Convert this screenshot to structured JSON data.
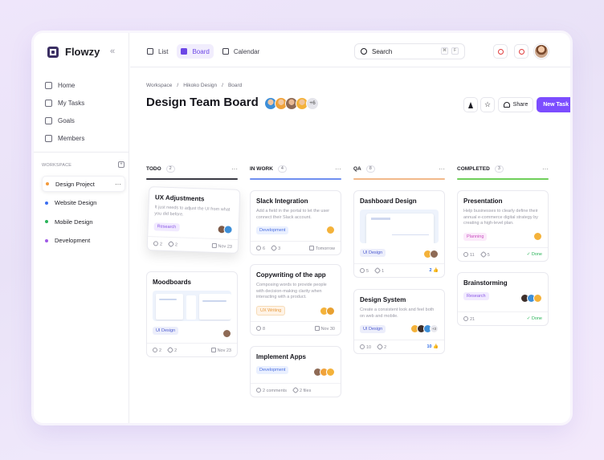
{
  "app": {
    "name": "Flowzy",
    "collapse_icon": "chevrons-left-icon"
  },
  "nav": [
    {
      "label": "Home",
      "icon": "home-icon"
    },
    {
      "label": "My Tasks",
      "icon": "check-square-icon"
    },
    {
      "label": "Goals",
      "icon": "trophy-icon"
    },
    {
      "label": "Members",
      "icon": "users-icon"
    }
  ],
  "workspace": {
    "label": "WORKSPACE",
    "projects": [
      {
        "label": "Design Project",
        "color": "#f39a3c",
        "active": true
      },
      {
        "label": "Website Design",
        "color": "#3b6ef0",
        "active": false
      },
      {
        "label": "Mobile Design",
        "color": "#2bb45a",
        "active": false
      },
      {
        "label": "Development",
        "color": "#a05be6",
        "active": false
      }
    ]
  },
  "views": [
    {
      "label": "List",
      "active": false
    },
    {
      "label": "Board",
      "active": true
    },
    {
      "label": "Calendar",
      "active": false
    }
  ],
  "search": {
    "label": "Search",
    "key1": "⌘",
    "key2": "F"
  },
  "breadcrumb": [
    "Workspace",
    "Hikoko Design",
    "Board"
  ],
  "page_title": "Design Team Board",
  "members_more": "+6",
  "actions": {
    "share": "Share",
    "new_task": "New Task"
  },
  "accent": "#7c4dff",
  "columns": [
    {
      "title": "TODO",
      "count": "2",
      "color": "#3a3a44"
    },
    {
      "title": "IN WORK",
      "count": "4",
      "color": "#6f8ff0"
    },
    {
      "title": "QA",
      "count": "8",
      "color": "#f2b98a"
    },
    {
      "title": "COMPLETED",
      "count": "3",
      "color": "#6fcf5a"
    }
  ],
  "cards": {
    "ux": {
      "title": "UX Adjustments",
      "desc": "It just needs to adjust the UI from what you did before.",
      "tag": "Research",
      "comments": "2",
      "links": "2",
      "date": "Nov 23"
    },
    "moodboards": {
      "title": "Moodboards",
      "tag": "UI Design",
      "comments": "2",
      "links": "2",
      "date": "Nov 23"
    },
    "slack": {
      "title": "Slack Integration",
      "desc": "Add a field in the portal to let the user connect their Slack account.",
      "tag": "Development",
      "comments": "6",
      "links": "3",
      "date": "Tomorrow"
    },
    "copy": {
      "title": "Copywriting of the app",
      "desc": "Composing words to provide people with decision-making clarity when interacting with a product.",
      "tag": "UX Writing",
      "comments": "8",
      "date": "Nov 30"
    },
    "apps": {
      "title": "Implement Apps",
      "tag": "Development",
      "comments": "2 comments",
      "links": "2 files"
    },
    "dash": {
      "title": "Dashboard Design",
      "tag": "UI Design",
      "comments": "5",
      "links": "1",
      "likes": "2"
    },
    "system": {
      "title": "Design System",
      "desc": "Create a consistent look and feel both on web and mobile.",
      "tag": "UI Design",
      "comments": "10",
      "links": "2",
      "likes": "10",
      "more": "+3"
    },
    "present": {
      "title": "Presentation",
      "desc": "Help businesses to clearly define their annual e-commerce digital strategy by creating a high-level plan.",
      "tag": "Planning",
      "comments": "11",
      "links": "5",
      "status": "Done"
    },
    "brain": {
      "title": "Brainstorming",
      "tag": "Research",
      "comments": "21",
      "status": "Done"
    }
  }
}
